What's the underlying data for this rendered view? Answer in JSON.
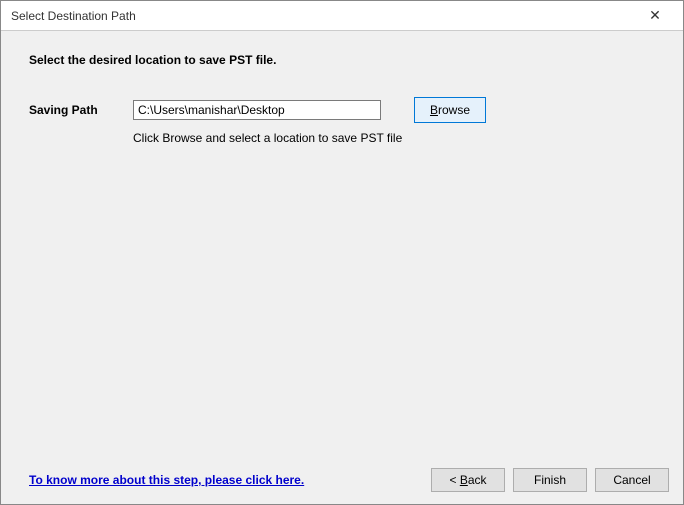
{
  "titlebar": {
    "title": "Select Destination Path",
    "close": "✕"
  },
  "content": {
    "instruction": "Select the desired location to save PST file.",
    "path_label": "Saving Path",
    "path_value": "C:\\Users\\manishar\\Desktop",
    "browse_label": "Browse",
    "hint": "Click Browse and select a location to save PST file"
  },
  "footer": {
    "help_link": "To know more about this step, please click here.",
    "back_prefix": "< ",
    "back_letter": "B",
    "back_rest": "ack",
    "finish": "Finish",
    "cancel": "Cancel"
  }
}
